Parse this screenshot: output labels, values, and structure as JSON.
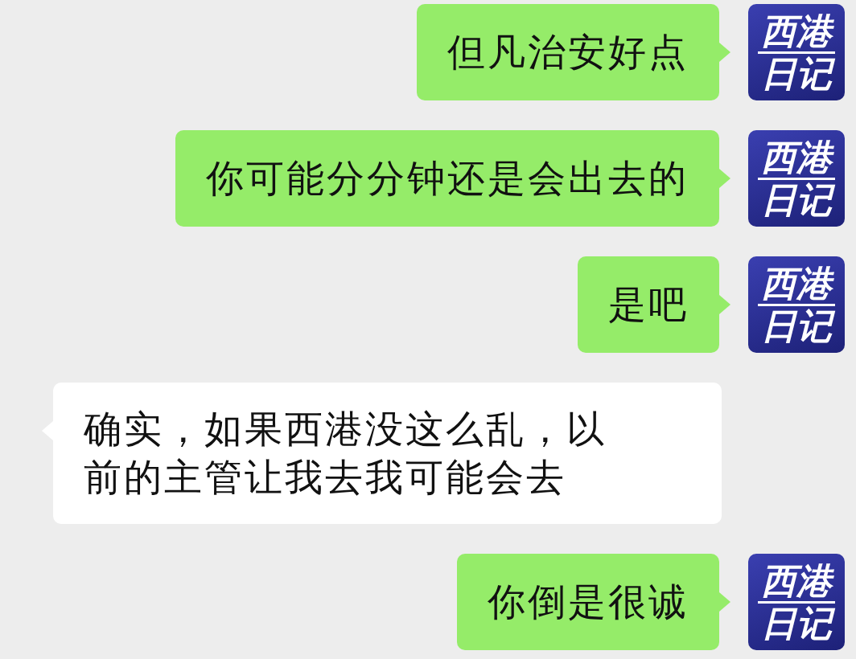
{
  "messages": [
    {
      "kind": "right",
      "text": "但凡治安好点",
      "avatar": {
        "line_1": "西港",
        "line_2": "日记"
      }
    },
    {
      "kind": "right",
      "text": "你可能分分钟还是会出去的",
      "avatar": {
        "line_1": "西港",
        "line_2": "日记"
      }
    },
    {
      "kind": "right",
      "text": "是吧",
      "avatar": {
        "line_1": "西港",
        "line_2": "日记"
      }
    },
    {
      "kind": "left",
      "text": "确实，如果西港没这么乱，以前的主管让我去我可能会去"
    },
    {
      "kind": "right",
      "text": "你倒是很诚",
      "avatar": {
        "line_1": "西港",
        "line_2": "日记"
      }
    }
  ]
}
